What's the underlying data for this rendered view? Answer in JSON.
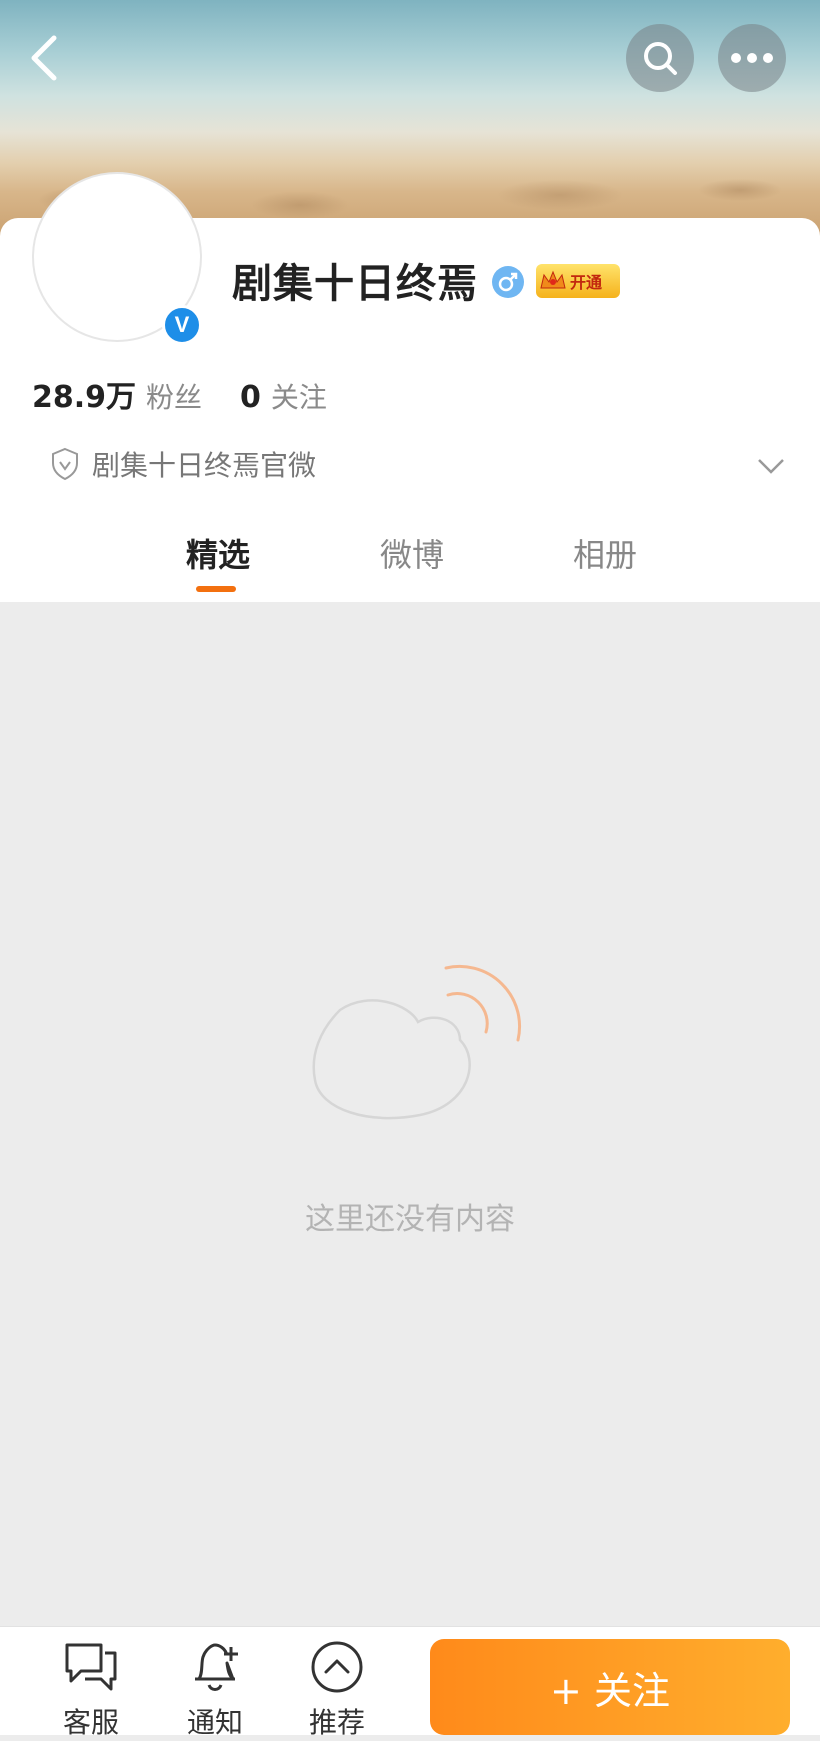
{
  "profile": {
    "name": "剧集十日终焉",
    "gender_icon": "male-icon",
    "vip_label": "开通",
    "followers_count": "28.9万",
    "followers_label": "粉丝",
    "following_count": "0",
    "following_label": "关注",
    "description": "剧集十日终焉官微",
    "verified_icon": "V"
  },
  "tabs": [
    {
      "label": "精选",
      "active": true
    },
    {
      "label": "微博",
      "active": false
    },
    {
      "label": "相册",
      "active": false
    }
  ],
  "empty_state": {
    "text": "这里还没有内容"
  },
  "bottom_bar": {
    "service_label": "客服",
    "notify_label": "通知",
    "recommend_label": "推荐",
    "follow_label": "+ 关注"
  },
  "colors": {
    "accent": "#f3700f",
    "follow_button": "#ff9a22",
    "verified": "#1e8ee8"
  }
}
